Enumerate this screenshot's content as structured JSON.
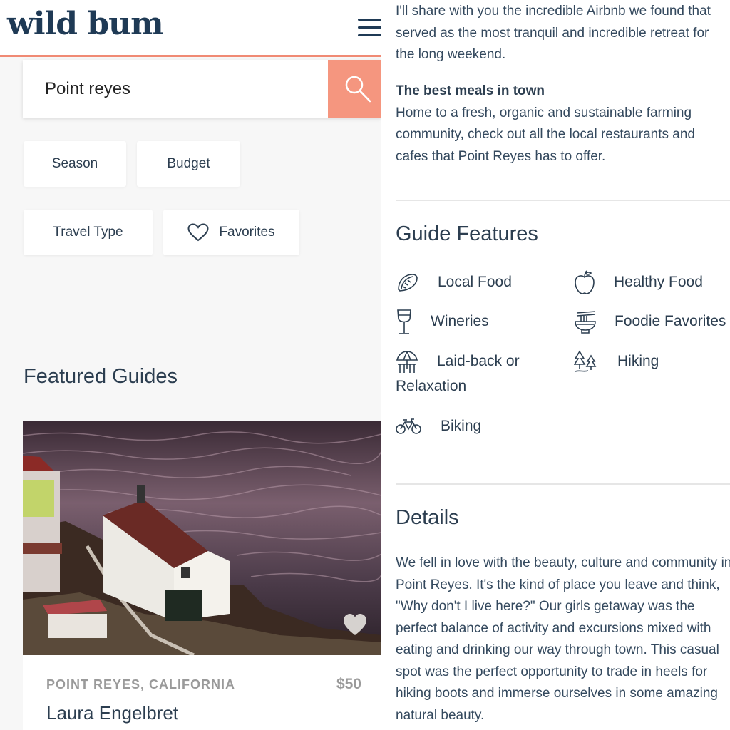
{
  "header": {
    "logo": "wild bum"
  },
  "search": {
    "value": "Point reyes",
    "placeholder": ""
  },
  "filters": {
    "season": "Season",
    "budget": "Budget",
    "travel_type": "Travel Type",
    "favorites": "Favorites"
  },
  "featured": {
    "title": "Featured Guides",
    "card": {
      "location": "POINT REYES, CALIFORNIA",
      "price": "$50",
      "author": "Laura Engelbret"
    }
  },
  "article": {
    "intro": "I'll share with you the incredible Airbnb we found that served as the most tranquil and incredible retreat for the long weekend.",
    "meals_heading": "The best meals in town",
    "meals_text": "Home to a fresh, organic and sustainable farming community, check out all the local restaurants and cafes that Point Reyes has to offer."
  },
  "guide_features": {
    "title": "Guide Features",
    "items": [
      {
        "label": "Local Food",
        "icon": "taco-icon"
      },
      {
        "label": "Healthy Food",
        "icon": "apple-icon"
      },
      {
        "label": "Wineries",
        "icon": "wine-glass-icon"
      },
      {
        "label": "Foodie Favorites",
        "icon": "noodle-bowl-icon"
      },
      {
        "label": "Laid-back or Relaxation",
        "icon": "beach-umbrella-icon"
      },
      {
        "label": "Hiking",
        "icon": "trees-icon"
      },
      {
        "label": "Biking",
        "icon": "bicycle-icon"
      }
    ]
  },
  "details": {
    "title": "Details",
    "text": "We fell in love with the beauty, culture and community in Point Reyes. It's the kind of place you leave and think, \"Why don't I live here?\" Our girls getaway was the perfect balance of activity and excursions mixed with eating and drinking our way through town. This casual spot was the perfect opportunity to trade in heels for hiking boots and immerse ourselves in some amazing natural beauty."
  },
  "colors": {
    "accent": "#f08a74",
    "search_button": "#f5967f",
    "navy": "#1f3a55",
    "text": "#2c3e50"
  }
}
